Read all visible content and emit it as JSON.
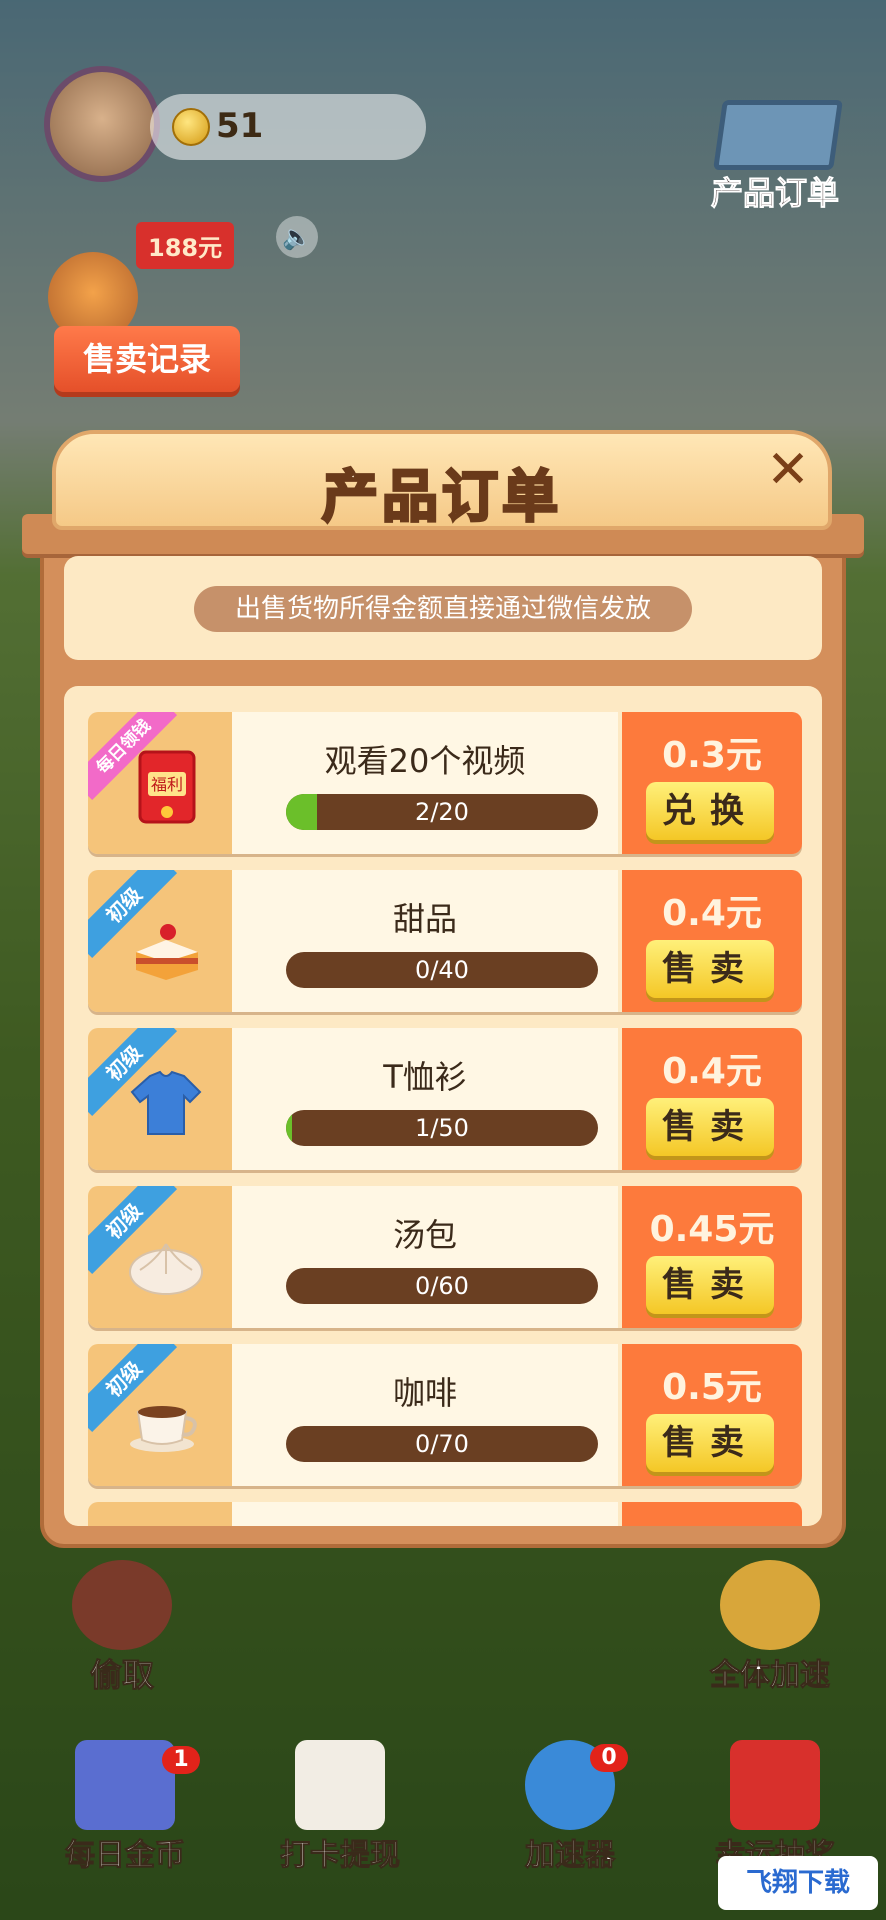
{
  "hud": {
    "coins": "51",
    "cart_label": "产品订单",
    "reward_badge": "188元",
    "sale_record": "售卖记录"
  },
  "dialog": {
    "title": "产品订单",
    "close_label": "✕",
    "notice": "出售货物所得金额直接通过微信发放"
  },
  "orders": [
    {
      "tag": "每日领钱",
      "title": "观看20个视频",
      "progress_text": "2/20",
      "progress": 0.1,
      "price": "0.3元",
      "action": "兑换",
      "icon": "red-envelope-icon",
      "icon_text": "福利"
    },
    {
      "tag": "初级",
      "title": "甜品",
      "progress_text": "0/40",
      "progress": 0.0,
      "price": "0.4元",
      "action": "售卖",
      "icon": "cake-icon"
    },
    {
      "tag": "初级",
      "title": "T恤衫",
      "progress_text": "1/50",
      "progress": 0.02,
      "price": "0.4元",
      "action": "售卖",
      "icon": "tshirt-icon"
    },
    {
      "tag": "初级",
      "title": "汤包",
      "progress_text": "0/60",
      "progress": 0.0,
      "price": "0.45元",
      "action": "售卖",
      "icon": "bun-icon"
    },
    {
      "tag": "初级",
      "title": "咖啡",
      "progress_text": "0/70",
      "progress": 0.0,
      "price": "0.5元",
      "action": "售卖",
      "icon": "coffee-icon"
    }
  ],
  "bottom": {
    "steal": "偷取",
    "speed_all": "全体加速",
    "daily_coins": "每日金币",
    "daily_coins_badge": "1",
    "checkin": "打卡提现",
    "accelerator": "加速器",
    "accelerator_badge": "0",
    "lucky": "幸运抽奖",
    "watermark": "飞翔下载"
  },
  "colors": {
    "accent": "#fd7a3c",
    "progress_fill": "#6bbf2a",
    "ribbon": "#3ea0e0",
    "ribbon_daily": "#f26ac8"
  }
}
